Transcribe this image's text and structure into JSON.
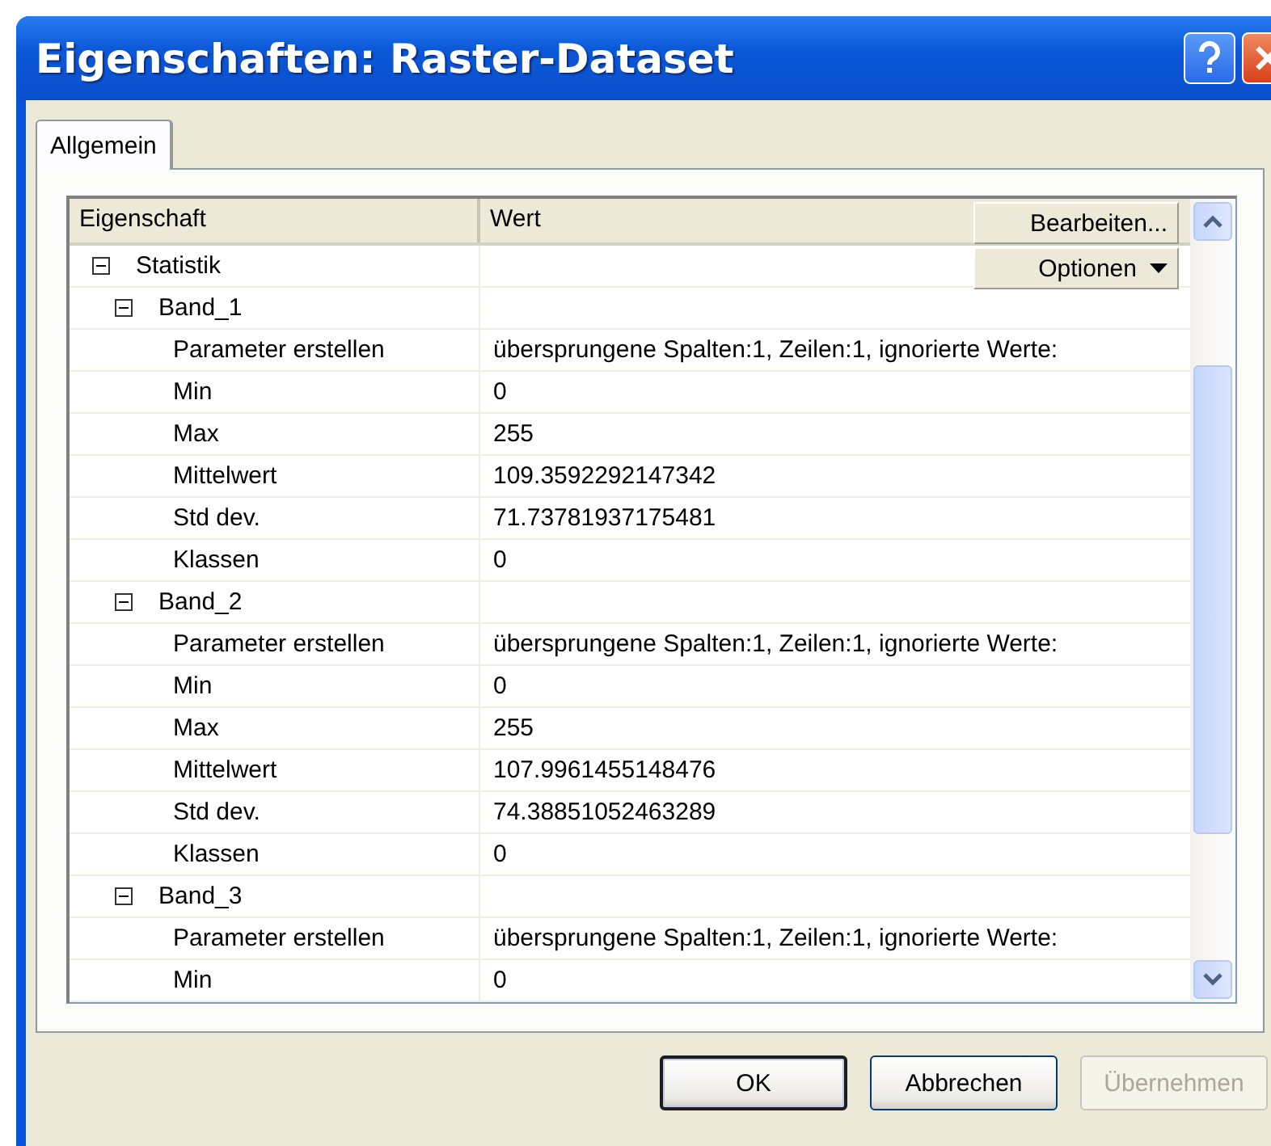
{
  "window": {
    "title": "Eigenschaften: Raster-Dataset"
  },
  "tabs": [
    {
      "label": "Allgemein",
      "selected": true
    }
  ],
  "grid": {
    "columns": [
      "Eigenschaft",
      "Wert"
    ],
    "tools": [
      {
        "label": "Bearbeiten...",
        "kind": "plain"
      },
      {
        "label": "Optionen",
        "kind": "menu"
      }
    ],
    "rows": [
      {
        "name": "Statistik",
        "expanded": true,
        "children": [
          {
            "name": "Band_1",
            "expanded": true,
            "children": [
              {
                "name": "Parameter erstellen",
                "value": "übersprungene Spalten:1, Zeilen:1, ignorierte Werte:"
              },
              {
                "name": "Min",
                "value": "0"
              },
              {
                "name": "Max",
                "value": "255"
              },
              {
                "name": "Mittelwert",
                "value": "109.3592292147342"
              },
              {
                "name": "Std dev.",
                "value": "71.73781937175481"
              },
              {
                "name": "Klassen",
                "value": "0"
              }
            ]
          },
          {
            "name": "Band_2",
            "expanded": true,
            "children": [
              {
                "name": "Parameter erstellen",
                "value": "übersprungene Spalten:1, Zeilen:1, ignorierte Werte:"
              },
              {
                "name": "Min",
                "value": "0"
              },
              {
                "name": "Max",
                "value": "255"
              },
              {
                "name": "Mittelwert",
                "value": "107.9961455148476"
              },
              {
                "name": "Std dev.",
                "value": "74.38851052463289"
              },
              {
                "name": "Klassen",
                "value": "0"
              }
            ]
          },
          {
            "name": "Band_3",
            "expanded": true,
            "children": [
              {
                "name": "Parameter erstellen",
                "value": "übersprungene Spalten:1, Zeilen:1, ignorierte Werte:"
              },
              {
                "name": "Min",
                "value": "0"
              }
            ]
          }
        ]
      }
    ]
  },
  "buttons": [
    {
      "label": "OK",
      "default": true,
      "disabled": false
    },
    {
      "label": "Abbrechen",
      "default": false,
      "disabled": false
    },
    {
      "label": "Übernehmen",
      "default": false,
      "disabled": true
    }
  ]
}
